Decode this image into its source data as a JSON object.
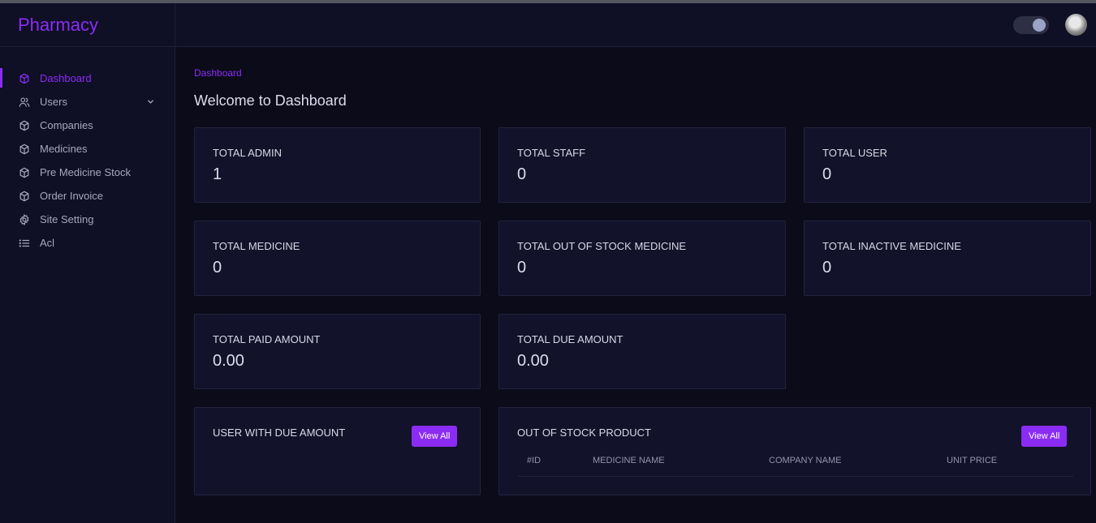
{
  "brand": "Pharmacy",
  "sidebar": {
    "items": [
      {
        "label": "Dashboard",
        "icon": "cube-icon"
      },
      {
        "label": "Users",
        "icon": "users-icon"
      },
      {
        "label": "Companies",
        "icon": "cube-icon"
      },
      {
        "label": "Medicines",
        "icon": "cube-icon"
      },
      {
        "label": "Pre Medicine Stock",
        "icon": "cube-icon"
      },
      {
        "label": "Order Invoice",
        "icon": "cube-icon"
      },
      {
        "label": "Site Setting",
        "icon": "gear-icon"
      },
      {
        "label": "Acl",
        "icon": "list-icon"
      }
    ]
  },
  "header": {
    "breadcrumb": "Dashboard",
    "title": "Welcome to Dashboard"
  },
  "stats": [
    {
      "label": "TOTAL ADMIN",
      "value": "1"
    },
    {
      "label": "TOTAL STAFF",
      "value": "0"
    },
    {
      "label": "TOTAL USER",
      "value": "0"
    },
    {
      "label": "TOTAL MEDICINE",
      "value": "0"
    },
    {
      "label": "TOTAL OUT OF STOCK MEDICINE",
      "value": "0"
    },
    {
      "label": "TOTAL INACTIVE MEDICINE",
      "value": "0"
    },
    {
      "label": "TOTAL PAID AMOUNT",
      "value": "0.00"
    },
    {
      "label": "TOTAL DUE AMOUNT",
      "value": "0.00"
    }
  ],
  "due_panel": {
    "title": "USER WITH DUE AMOUNT",
    "button": "View All"
  },
  "stock_panel": {
    "title": "OUT OF STOCK PRODUCT",
    "button": "View All",
    "columns": [
      "#ID",
      "MEDICINE NAME",
      "COMPANY NAME",
      "UNIT PRICE"
    ]
  },
  "colors": {
    "accent": "#8b2cf5",
    "background": "#0b0b1a",
    "panel": "#12122a",
    "sidebar": "#0f0f25"
  }
}
